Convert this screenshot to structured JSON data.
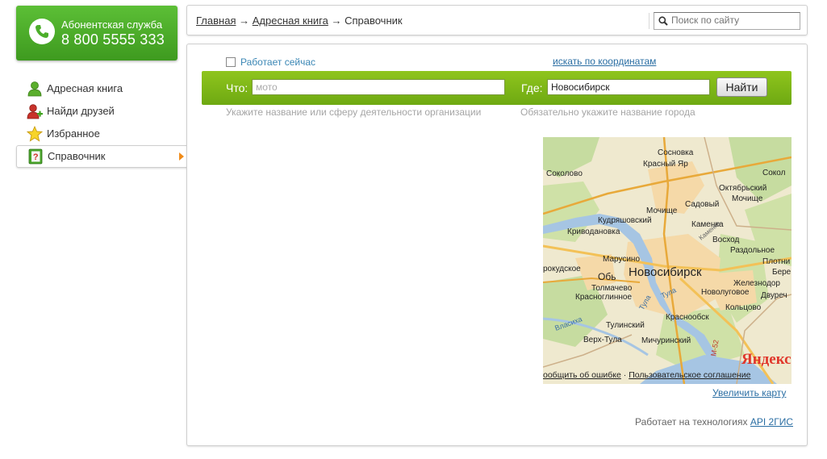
{
  "support": {
    "caption": "Абонентская служба",
    "phone": "8 800 5555 333"
  },
  "sidebar": {
    "items": [
      {
        "label": "Адресная книга",
        "icon": "user-icon",
        "active": false
      },
      {
        "label": "Найди друзей",
        "icon": "add-user-icon",
        "active": false
      },
      {
        "label": "Избранное",
        "icon": "star-icon",
        "active": false
      },
      {
        "label": "Справочник",
        "icon": "help-book-icon",
        "active": true
      }
    ]
  },
  "breadcrumb": {
    "home": "Главная",
    "sep1": "→",
    "address_book": "Адресная книга",
    "sep2": "→",
    "current": "Справочник"
  },
  "site_search": {
    "placeholder": "Поиск по сайту"
  },
  "search": {
    "open_now_label": "Работает сейчас",
    "coords_link": "искать по координатам",
    "what_label": "Что:",
    "what_placeholder": "мото",
    "where_label": "Где:",
    "where_value": "Новосибирск",
    "find_button": "Найти",
    "what_hint": "Укажите название или сферу деятельности организации",
    "where_hint": "Обязательно укажите название города"
  },
  "map": {
    "brand": "Яндекс",
    "footer_error": "ообщить об ошибке",
    "footer_sep": "·",
    "footer_agreement": "Пользовательское соглашение",
    "enlarge_link": "Увеличить карту",
    "places": [
      "Сосновка",
      "Красный Яр",
      "Сокол",
      "Соколово",
      "Октябрьский",
      "Садовый",
      "Мочище",
      "Мочище",
      "Кудряшовский",
      "Каменка",
      "Криводановка",
      "Восход",
      "Раздольное",
      "Марусино",
      "Плотни",
      "рокудское",
      "Обь",
      "Новосибирск",
      "Бере",
      "Толмачево",
      "Новолуговое",
      "Железнодор",
      "Красноглинное",
      "Двуреч",
      "Кольцово",
      "Краснообск",
      "Тулинский",
      "Верх-Тула",
      "Мичуринский",
      "Тула",
      "Тула",
      "Власиха",
      "Каменка",
      "М-52"
    ]
  },
  "footer": {
    "tech_text": "Работает на технологиях",
    "tech_link": "API 2ГИС"
  },
  "colors": {
    "support_green": "#4cae2a",
    "search_bar_green": "#7fb718",
    "link_blue": "#2a6ea3",
    "arrow_orange": "#f08c1a",
    "brand_red": "#e0362b"
  }
}
